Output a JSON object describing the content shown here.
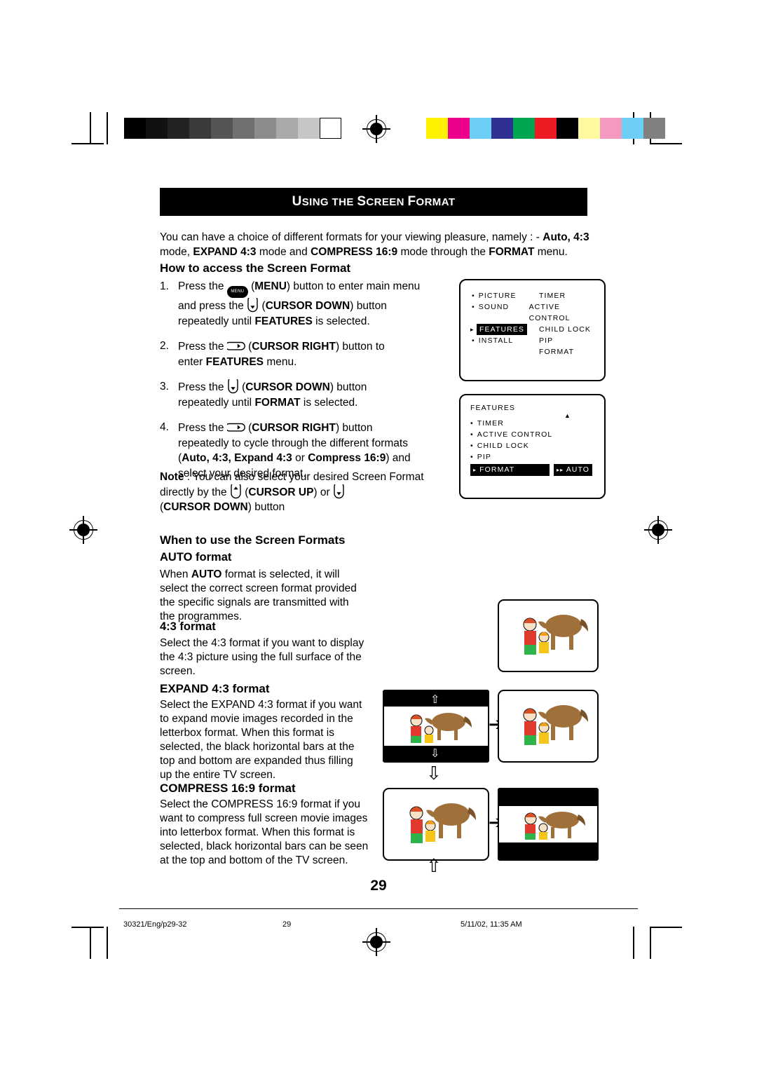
{
  "banner": {
    "title_first": "U",
    "title_rest": "SING THE ",
    "title_s": "S",
    "title_screen": "CREEN ",
    "title_f": "F",
    "title_format": "ORMAT",
    "full": "USING THE SCREEN FORMAT"
  },
  "intro": {
    "line1_a": "You can have a choice of different formats for your viewing pleasure, namely : - ",
    "line1_b": "Auto, ",
    "line1_c": "4:3",
    "line2_a": "mode, ",
    "line2_b": "EXPAND 4:3",
    "line2_c": " mode and ",
    "line2_d": "COMPRESS 16:9",
    "line2_e": " mode through the ",
    "line2_f": "FORMAT",
    "line2_g": " menu."
  },
  "section_access": {
    "heading": "How to access the Screen Format"
  },
  "steps": [
    {
      "num": "1.",
      "a": "Press the ",
      "icon": "menu-button-icon",
      "icon_label": "MENU",
      "b": " (",
      "bold1": "MENU",
      "c": ") button to enter main menu",
      "d": "and press the ",
      "icon2": "cursor-down-icon",
      "e": " (",
      "bold2": "CURSOR DOWN",
      "f": ") button",
      "g": "repeatedly until ",
      "bold3": "FEATURES",
      "h": " is selected."
    },
    {
      "num": "2.",
      "a": "Press the ",
      "icon": "cursor-right-icon",
      "b": " (",
      "bold1": "CURSOR RIGHT",
      "c": ") button to",
      "d": "enter ",
      "bold2": "FEATURES",
      "e": " menu."
    },
    {
      "num": "3.",
      "a": "Press the ",
      "icon": "cursor-down-icon",
      "b": " (",
      "bold1": "CURSOR DOWN",
      "c": ") button",
      "d": "repeatedly until ",
      "bold2": "FORMAT",
      "e": " is selected."
    },
    {
      "num": "4.",
      "a": "Press the ",
      "icon": "cursor-right-icon",
      "b": " (",
      "bold1": "CURSOR RIGHT",
      "c": ") button",
      "d": "repeatedly to cycle through the different formats",
      "e": "(",
      "bold2": "Auto, 4:3, Expand 4:3",
      "f": " or ",
      "bold3": "Compress 16:9",
      "g": ") and",
      "h": "select your desired format."
    }
  ],
  "note": {
    "label": "Note",
    "a": " :  You can also select your desired Screen Format",
    "b": "directly by the ",
    "c": " (",
    "bold1": "CURSOR UP",
    "d": ") or ",
    "e": "(",
    "bold2": "CURSOR DOWN",
    "f": ") button"
  },
  "osd_main": {
    "rows": [
      {
        "left": "PICTURE",
        "right": "TIMER",
        "left_bullet": true,
        "left_hl": false
      },
      {
        "left": "SOUND",
        "right": "ACTIVE CONTROL",
        "left_bullet": true,
        "left_hl": false
      },
      {
        "left": "FEATURES",
        "right": "CHILD LOCK",
        "left_bullet": true,
        "left_hl": true
      },
      {
        "left": "INSTALL",
        "right": "PIP",
        "left_bullet": true,
        "left_hl": false
      },
      {
        "left": "",
        "right": "FORMAT",
        "left_bullet": false,
        "left_hl": false
      }
    ]
  },
  "osd_features": {
    "title": "FEATURES",
    "rows": [
      {
        "label": "TIMER",
        "hl": false,
        "value": ""
      },
      {
        "label": "ACTIVE CONTROL",
        "hl": false,
        "value": ""
      },
      {
        "label": "CHILD LOCK",
        "hl": false,
        "value": ""
      },
      {
        "label": "PIP",
        "hl": false,
        "value": ""
      },
      {
        "label": "FORMAT",
        "hl": true,
        "value": "AUTO"
      }
    ]
  },
  "section_when": {
    "heading": "When to use the Screen Formats"
  },
  "auto": {
    "heading": "AUTO format",
    "l1_a": "When ",
    "l1_b": "AUTO",
    "l1_c": " format is selected, it will",
    "l2": "select the correct screen format provided",
    "l3": "the specific signals are transmitted with",
    "l4": "the programmes."
  },
  "four_three": {
    "heading": "4:3 format",
    "l1": "Select the 4:3 format if you want to display",
    "l2": "the 4:3 picture using the full surface of the",
    "l3": "screen."
  },
  "expand": {
    "heading": "EXPAND 4:3 format",
    "l1": "Select the EXPAND 4:3 format if you want",
    "l2": "to expand movie images recorded in the",
    "l3": "letterbox format. When this format is",
    "l4": "selected, the black horizontal bars at the",
    "l5": "top and bottom are expanded thus filling",
    "l6": "up the entire TV screen."
  },
  "compress": {
    "heading": "COMPRESS 16:9 format",
    "l1": "Select the COMPRESS 16:9 format if you",
    "l2": "want to compress full screen movie images",
    "l3": "into letterbox format. When this format is",
    "l4": "selected, black horizontal bars can be seen",
    "l5": "at the top and bottom of the TV screen."
  },
  "page_number": "29",
  "footer": {
    "left": "30321/Eng/p29-32",
    "center": "29",
    "right": "5/11/02, 11:35 AM"
  },
  "colors": {
    "accent_black": "#000000",
    "bar_yellow": "#fff200",
    "bar_magenta": "#ec008c",
    "bar_blue": "#2e3192",
    "bar_green": "#00a651",
    "bar_red": "#ed1c24",
    "bar_lightyellow": "#fff9a0",
    "bar_pink": "#f49ac1",
    "bar_cyan": "#6dcff6",
    "bar_gray": "#808080"
  }
}
